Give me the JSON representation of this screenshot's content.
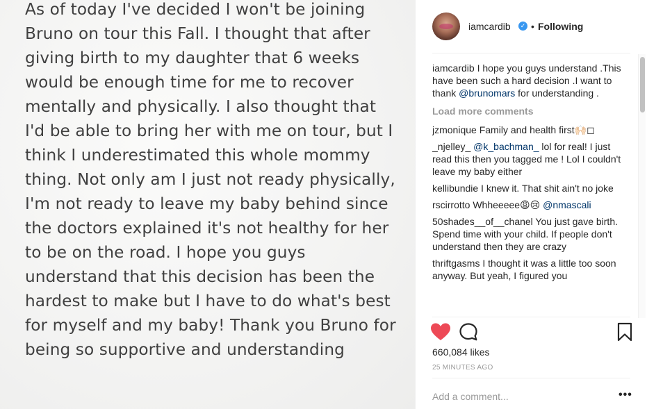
{
  "post": {
    "image_text": "As of today I've decided I won't be joining Bruno on tour this Fall. I thought that after giving birth to my daughter that 6 weeks would be enough time for me to recover mentally and physically. I also thought that I'd be able to bring her with me on tour, but I think I underestimated this whole mommy thing. Not only am I just not ready physically, I'm not ready to leave my baby behind since the doctors explained it's not healthy for her to be on the road. I hope you guys understand that this decision has been the hardest to make but I have to do what's best for myself and my baby! Thank you Bruno for being so supportive and understanding"
  },
  "header": {
    "username": "iamcardib",
    "verified_glyph": "✓",
    "separator": "•",
    "follow_status": "Following"
  },
  "caption": {
    "username": "iamcardib",
    "text_before": " I hope you guys understand .This have been such a hard decision .I want to thank ",
    "mention": "@brunomars",
    "text_after": " for understanding ."
  },
  "load_more": "Load more comments",
  "comments": [
    {
      "username": "jzmonique",
      "text": " Family and health first🙌🏻◻"
    },
    {
      "username": "_njelley_",
      "mention": "@k_bachman_",
      "text": "  lol for real! I just read this then you tagged me ! Lol I couldn't leave my baby either"
    },
    {
      "username": "kellibundie",
      "text": " I knew it. That shit ain't no joke"
    },
    {
      "username": "rscirrotto",
      "text": " Whheeeee😩😢 ",
      "mention_after": "@nmascali"
    },
    {
      "username": "50shades__of__chanel",
      "text": " You just gave birth. Spend time with your child. If people don't understand then they are crazy"
    },
    {
      "username": "thriftgasms",
      "text": " I thought it was a little too soon anyway. But yeah, I figured you"
    }
  ],
  "actions": {
    "like_icon": "heart-filled-icon",
    "comment_icon": "comment-bubble-icon",
    "save_icon": "bookmark-icon",
    "like_color": "#ed4956"
  },
  "likes": "660,084 likes",
  "timestamp": "25 MINUTES AGO",
  "add_comment_placeholder": "Add a comment...",
  "more_label": "•••"
}
